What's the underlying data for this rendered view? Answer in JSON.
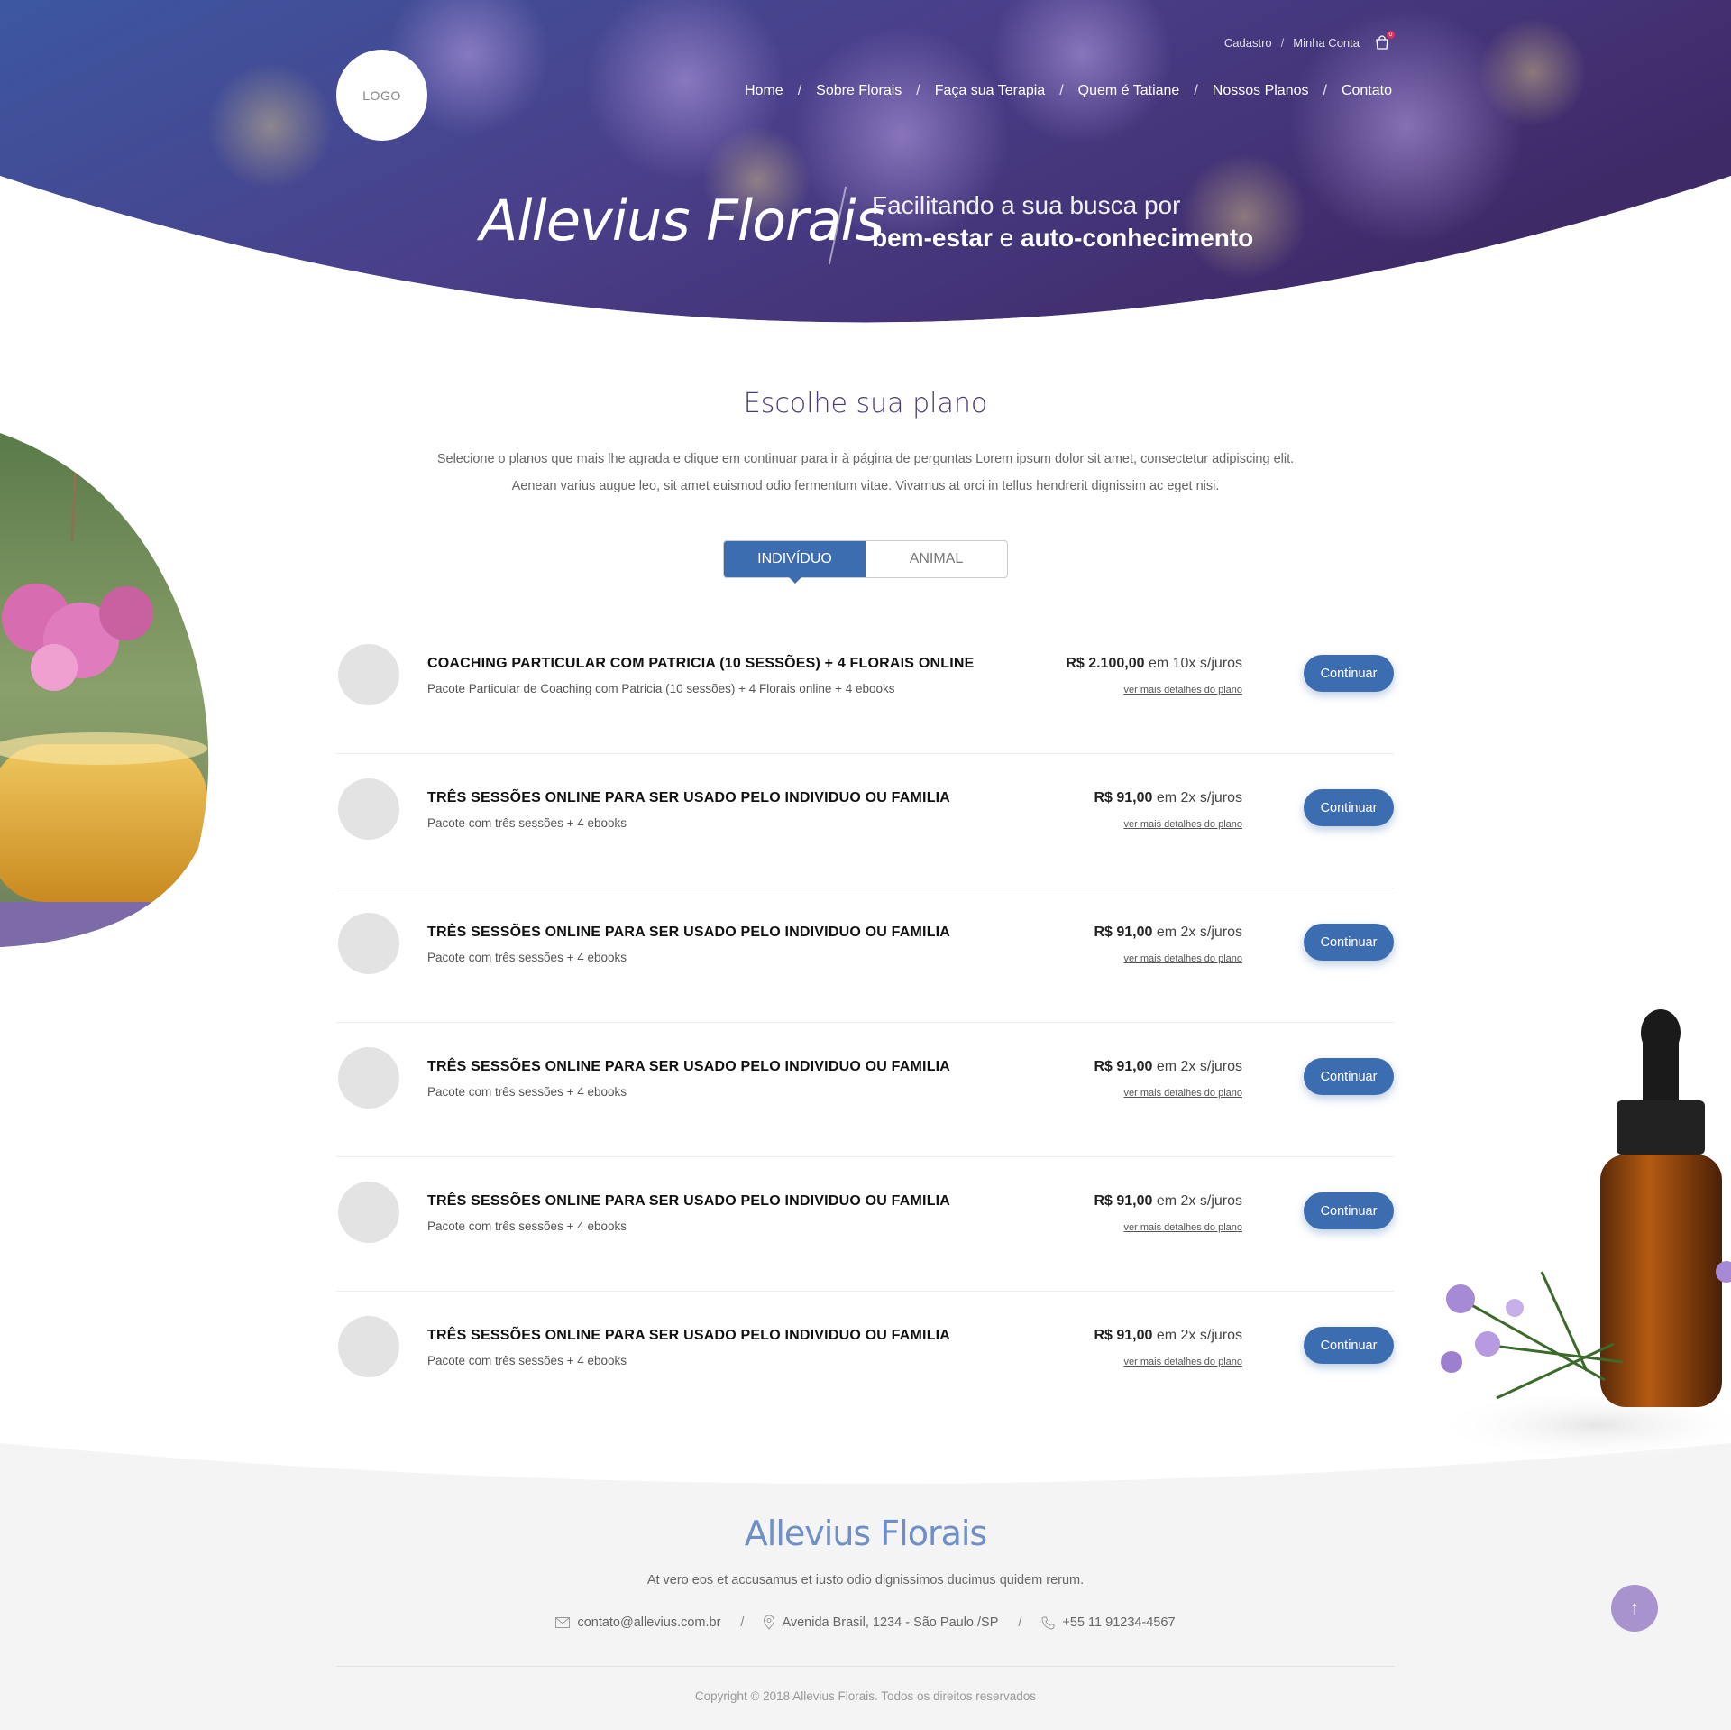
{
  "header": {
    "logo": "LOGO",
    "top_links": [
      "Cadastro",
      "Minha Conta"
    ],
    "cart_count": "0",
    "nav": [
      "Home",
      "Sobre Florais",
      "Faça sua Terapia",
      "Quem é Tatiane",
      "Nossos Planos",
      "Contato"
    ],
    "separator": "/"
  },
  "hero": {
    "title": "Allevius Florais",
    "tagline_line1": "Facilitando a sua busca por",
    "tagline_bold1": "bem-estar",
    "tagline_and": "e",
    "tagline_bold2": "auto-conhecimento"
  },
  "section": {
    "title": "Escolhe sua plano",
    "desc_line1": "Selecione o planos que mais lhe agrada e clique em continuar para ir à página de perguntas Lorem ipsum dolor sit amet, consectetur adipiscing elit.",
    "desc_line2": "Aenean varius augue leo, sit amet euismod odio fermentum vitae. Vivamus at orci in tellus hendrerit dignissim ac eget nisi."
  },
  "tabs": [
    "INDIVÍDUO",
    "ANIMAL"
  ],
  "plans": [
    {
      "name": "COACHING  PARTICULAR COM PATRICIA (10 SESSÕES) + 4 FLORAIS ONLINE",
      "desc": "Pacote Particular de Coaching com Patricia (10 sessões) + 4 Florais online + 4 ebooks",
      "price": "R$ 2.100,00",
      "terms": "em 10x s/juros",
      "details": "ver mais detalhes do plano",
      "button": "Continuar"
    },
    {
      "name": "TRÊS SESSÕES ONLINE PARA SER USADO PELO INDIVIDUO OU FAMILIA",
      "desc": "Pacote com três sessões + 4 ebooks",
      "price": "R$ 91,00",
      "terms": "em 2x s/juros",
      "details": "ver mais detalhes do plano",
      "button": "Continuar"
    },
    {
      "name": "TRÊS SESSÕES ONLINE PARA SER USADO PELO INDIVIDUO OU FAMILIA",
      "desc": "Pacote com três sessões + 4 ebooks",
      "price": "R$ 91,00",
      "terms": "em 2x s/juros",
      "details": "ver mais detalhes do plano",
      "button": "Continuar"
    },
    {
      "name": "TRÊS SESSÕES ONLINE PARA SER USADO PELO INDIVIDUO OU FAMILIA",
      "desc": "Pacote com três sessões + 4 ebooks",
      "price": "R$ 91,00",
      "terms": "em 2x s/juros",
      "details": "ver mais detalhes do plano",
      "button": "Continuar"
    },
    {
      "name": "TRÊS SESSÕES ONLINE PARA SER USADO PELO INDIVIDUO OU FAMILIA",
      "desc": "Pacote com três sessões + 4 ebooks",
      "price": "R$ 91,00",
      "terms": "em 2x s/juros",
      "details": "ver mais detalhes do plano",
      "button": "Continuar"
    },
    {
      "name": "TRÊS SESSÕES ONLINE PARA SER USADO PELO INDIVIDUO OU FAMILIA",
      "desc": "Pacote com três sessões + 4 ebooks",
      "price": "R$ 91,00",
      "terms": "em 2x s/juros",
      "details": "ver mais detalhes do plano",
      "button": "Continuar"
    }
  ],
  "footer": {
    "brand": "Allevius Florais",
    "text": "At vero eos et accusamus et iusto odio dignissimos ducimus quidem rerum.",
    "email": "contato@allevius.com.br",
    "address": "Avenida Brasil, 1234 - São Paulo /SP",
    "phone": "+55 11 91234-4567",
    "separator": "/",
    "copyright": "Copyright © 2018 Allevius Florais. Todos os direitos reservados",
    "to_top": "↑"
  },
  "colors": {
    "primary": "#3d6db1",
    "hero_start": "#3c4f9c",
    "hero_end": "#4b2d78",
    "title": "#4a3a70",
    "brand_footer": "#6e8fc7",
    "to_top": "#a993cf"
  },
  "icons": [
    "cart-icon",
    "mail-icon",
    "location-icon",
    "phone-icon",
    "arrow-up-icon"
  ]
}
